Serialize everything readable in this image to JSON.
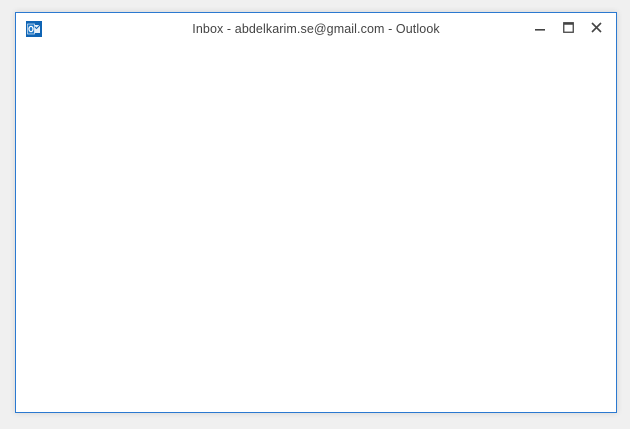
{
  "window": {
    "title": "Inbox - abdelkarim.se@gmail.com - Outlook",
    "app_icon": "outlook-icon",
    "border_color": "#2b79d0",
    "brand_color": "#0f64b4"
  },
  "controls": {
    "minimize_icon": "minimize-icon",
    "maximize_icon": "maximize-icon",
    "close_icon": "close-icon"
  }
}
